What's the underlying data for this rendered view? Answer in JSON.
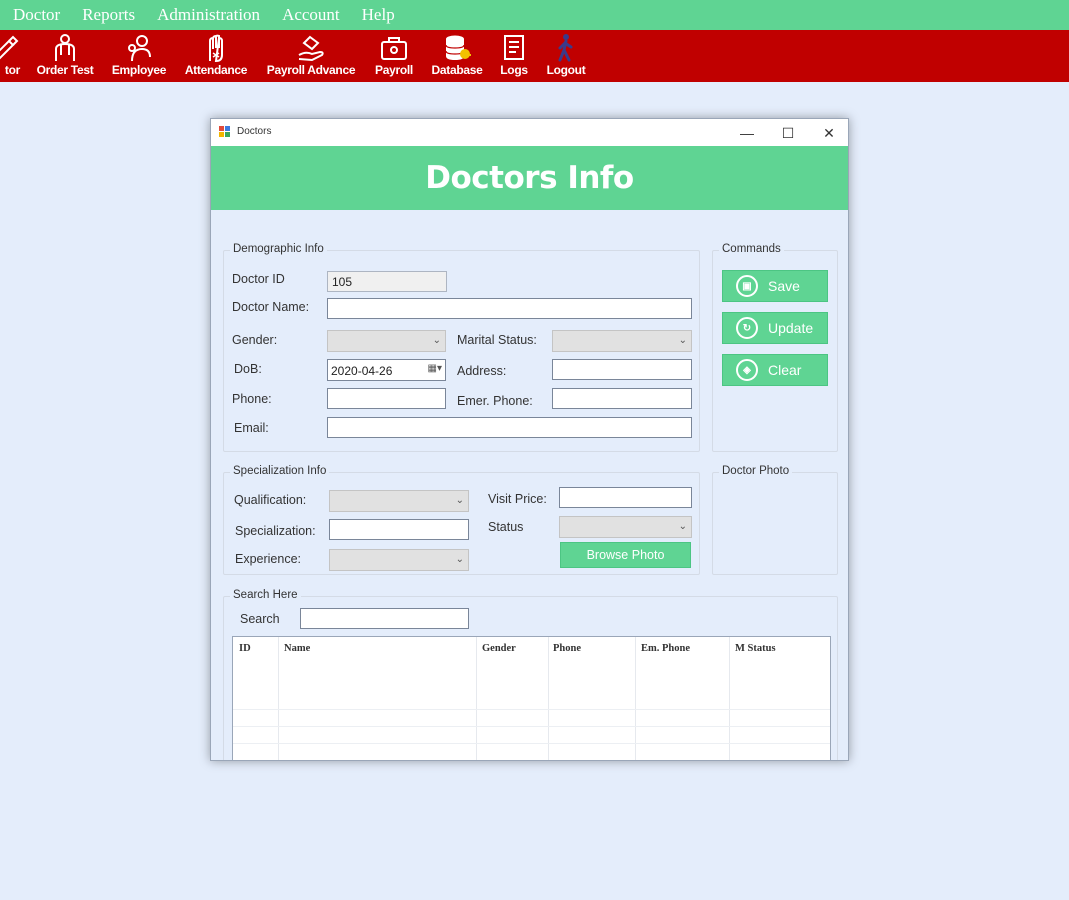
{
  "menu": [
    "Doctor",
    "Reports",
    "Administration",
    "Account",
    "Help"
  ],
  "toolbar": {
    "items": [
      {
        "label": "tor",
        "icon": "doctor-icon"
      },
      {
        "label": "Order Test",
        "icon": "order-test-icon"
      },
      {
        "label": "Employee",
        "icon": "employee-icon"
      },
      {
        "label": "Attendance",
        "icon": "attendance-icon"
      },
      {
        "label": "Payroll Advance",
        "icon": "payroll-advance-icon"
      },
      {
        "label": "Payroll",
        "icon": "payroll-icon"
      },
      {
        "label": "Database",
        "icon": "database-icon"
      },
      {
        "label": "Logs",
        "icon": "logs-icon"
      },
      {
        "label": "Logout",
        "icon": "logout-icon"
      }
    ]
  },
  "window": {
    "title": "Doctors",
    "header": "Doctors Info",
    "controls": {
      "minimize": "—",
      "maximize": "☐",
      "close": "✕"
    }
  },
  "demographic": {
    "group_title": "Demographic Info",
    "doctor_id_label": "Doctor ID",
    "doctor_id_value": "105",
    "doctor_name_label": "Doctor Name:",
    "doctor_name_value": "",
    "gender_label": "Gender:",
    "gender_value": "",
    "marital_label": "Marital Status:",
    "marital_value": "",
    "dob_label": "DoB:",
    "dob_value": "2020-04-26",
    "address_label": "Address:",
    "address_value": "",
    "phone_label": "Phone:",
    "phone_value": "",
    "emer_phone_label": "Emer. Phone:",
    "emer_phone_value": "",
    "email_label": "Email:",
    "email_value": ""
  },
  "commands": {
    "group_title": "Commands",
    "save": "Save",
    "update": "Update",
    "clear": "Clear"
  },
  "specialization": {
    "group_title": "Specialization Info",
    "qualification_label": "Qualification:",
    "qualification_value": "",
    "specialization_label": "Specialization:",
    "specialization_value": "",
    "experience_label": "Experience:",
    "experience_value": "",
    "visit_price_label": "Visit Price:",
    "visit_price_value": "",
    "status_label": "Status",
    "status_value": "",
    "browse_label": "Browse Photo"
  },
  "photo": {
    "group_title": "Doctor Photo"
  },
  "search": {
    "group_title": "Search Here",
    "label": "Search",
    "value": ""
  },
  "table": {
    "columns": [
      "ID",
      "Name",
      "Gender",
      "Phone",
      "Em. Phone",
      "M Status"
    ],
    "rows": []
  },
  "colors": {
    "menubar": "#5fd493",
    "toolbar": "#c00000",
    "accent": "#5fd493",
    "background": "#e4edfb"
  }
}
